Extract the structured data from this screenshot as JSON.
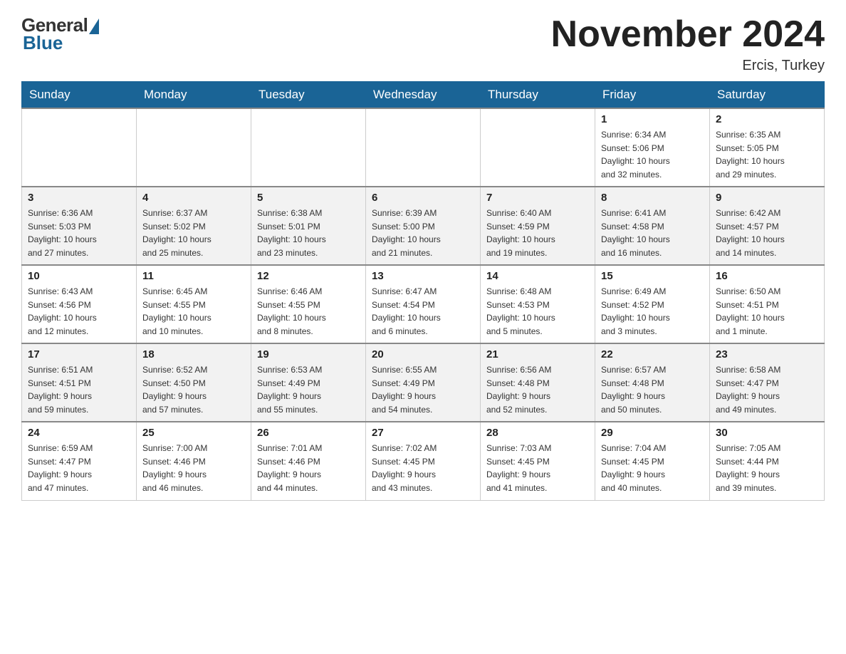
{
  "logo": {
    "general_text": "General",
    "blue_text": "Blue"
  },
  "header": {
    "month_title": "November 2024",
    "location": "Ercis, Turkey"
  },
  "weekdays": [
    "Sunday",
    "Monday",
    "Tuesday",
    "Wednesday",
    "Thursday",
    "Friday",
    "Saturday"
  ],
  "weeks": [
    [
      {
        "day": "",
        "info": ""
      },
      {
        "day": "",
        "info": ""
      },
      {
        "day": "",
        "info": ""
      },
      {
        "day": "",
        "info": ""
      },
      {
        "day": "",
        "info": ""
      },
      {
        "day": "1",
        "info": "Sunrise: 6:34 AM\nSunset: 5:06 PM\nDaylight: 10 hours\nand 32 minutes."
      },
      {
        "day": "2",
        "info": "Sunrise: 6:35 AM\nSunset: 5:05 PM\nDaylight: 10 hours\nand 29 minutes."
      }
    ],
    [
      {
        "day": "3",
        "info": "Sunrise: 6:36 AM\nSunset: 5:03 PM\nDaylight: 10 hours\nand 27 minutes."
      },
      {
        "day": "4",
        "info": "Sunrise: 6:37 AM\nSunset: 5:02 PM\nDaylight: 10 hours\nand 25 minutes."
      },
      {
        "day": "5",
        "info": "Sunrise: 6:38 AM\nSunset: 5:01 PM\nDaylight: 10 hours\nand 23 minutes."
      },
      {
        "day": "6",
        "info": "Sunrise: 6:39 AM\nSunset: 5:00 PM\nDaylight: 10 hours\nand 21 minutes."
      },
      {
        "day": "7",
        "info": "Sunrise: 6:40 AM\nSunset: 4:59 PM\nDaylight: 10 hours\nand 19 minutes."
      },
      {
        "day": "8",
        "info": "Sunrise: 6:41 AM\nSunset: 4:58 PM\nDaylight: 10 hours\nand 16 minutes."
      },
      {
        "day": "9",
        "info": "Sunrise: 6:42 AM\nSunset: 4:57 PM\nDaylight: 10 hours\nand 14 minutes."
      }
    ],
    [
      {
        "day": "10",
        "info": "Sunrise: 6:43 AM\nSunset: 4:56 PM\nDaylight: 10 hours\nand 12 minutes."
      },
      {
        "day": "11",
        "info": "Sunrise: 6:45 AM\nSunset: 4:55 PM\nDaylight: 10 hours\nand 10 minutes."
      },
      {
        "day": "12",
        "info": "Sunrise: 6:46 AM\nSunset: 4:55 PM\nDaylight: 10 hours\nand 8 minutes."
      },
      {
        "day": "13",
        "info": "Sunrise: 6:47 AM\nSunset: 4:54 PM\nDaylight: 10 hours\nand 6 minutes."
      },
      {
        "day": "14",
        "info": "Sunrise: 6:48 AM\nSunset: 4:53 PM\nDaylight: 10 hours\nand 5 minutes."
      },
      {
        "day": "15",
        "info": "Sunrise: 6:49 AM\nSunset: 4:52 PM\nDaylight: 10 hours\nand 3 minutes."
      },
      {
        "day": "16",
        "info": "Sunrise: 6:50 AM\nSunset: 4:51 PM\nDaylight: 10 hours\nand 1 minute."
      }
    ],
    [
      {
        "day": "17",
        "info": "Sunrise: 6:51 AM\nSunset: 4:51 PM\nDaylight: 9 hours\nand 59 minutes."
      },
      {
        "day": "18",
        "info": "Sunrise: 6:52 AM\nSunset: 4:50 PM\nDaylight: 9 hours\nand 57 minutes."
      },
      {
        "day": "19",
        "info": "Sunrise: 6:53 AM\nSunset: 4:49 PM\nDaylight: 9 hours\nand 55 minutes."
      },
      {
        "day": "20",
        "info": "Sunrise: 6:55 AM\nSunset: 4:49 PM\nDaylight: 9 hours\nand 54 minutes."
      },
      {
        "day": "21",
        "info": "Sunrise: 6:56 AM\nSunset: 4:48 PM\nDaylight: 9 hours\nand 52 minutes."
      },
      {
        "day": "22",
        "info": "Sunrise: 6:57 AM\nSunset: 4:48 PM\nDaylight: 9 hours\nand 50 minutes."
      },
      {
        "day": "23",
        "info": "Sunrise: 6:58 AM\nSunset: 4:47 PM\nDaylight: 9 hours\nand 49 minutes."
      }
    ],
    [
      {
        "day": "24",
        "info": "Sunrise: 6:59 AM\nSunset: 4:47 PM\nDaylight: 9 hours\nand 47 minutes."
      },
      {
        "day": "25",
        "info": "Sunrise: 7:00 AM\nSunset: 4:46 PM\nDaylight: 9 hours\nand 46 minutes."
      },
      {
        "day": "26",
        "info": "Sunrise: 7:01 AM\nSunset: 4:46 PM\nDaylight: 9 hours\nand 44 minutes."
      },
      {
        "day": "27",
        "info": "Sunrise: 7:02 AM\nSunset: 4:45 PM\nDaylight: 9 hours\nand 43 minutes."
      },
      {
        "day": "28",
        "info": "Sunrise: 7:03 AM\nSunset: 4:45 PM\nDaylight: 9 hours\nand 41 minutes."
      },
      {
        "day": "29",
        "info": "Sunrise: 7:04 AM\nSunset: 4:45 PM\nDaylight: 9 hours\nand 40 minutes."
      },
      {
        "day": "30",
        "info": "Sunrise: 7:05 AM\nSunset: 4:44 PM\nDaylight: 9 hours\nand 39 minutes."
      }
    ]
  ]
}
